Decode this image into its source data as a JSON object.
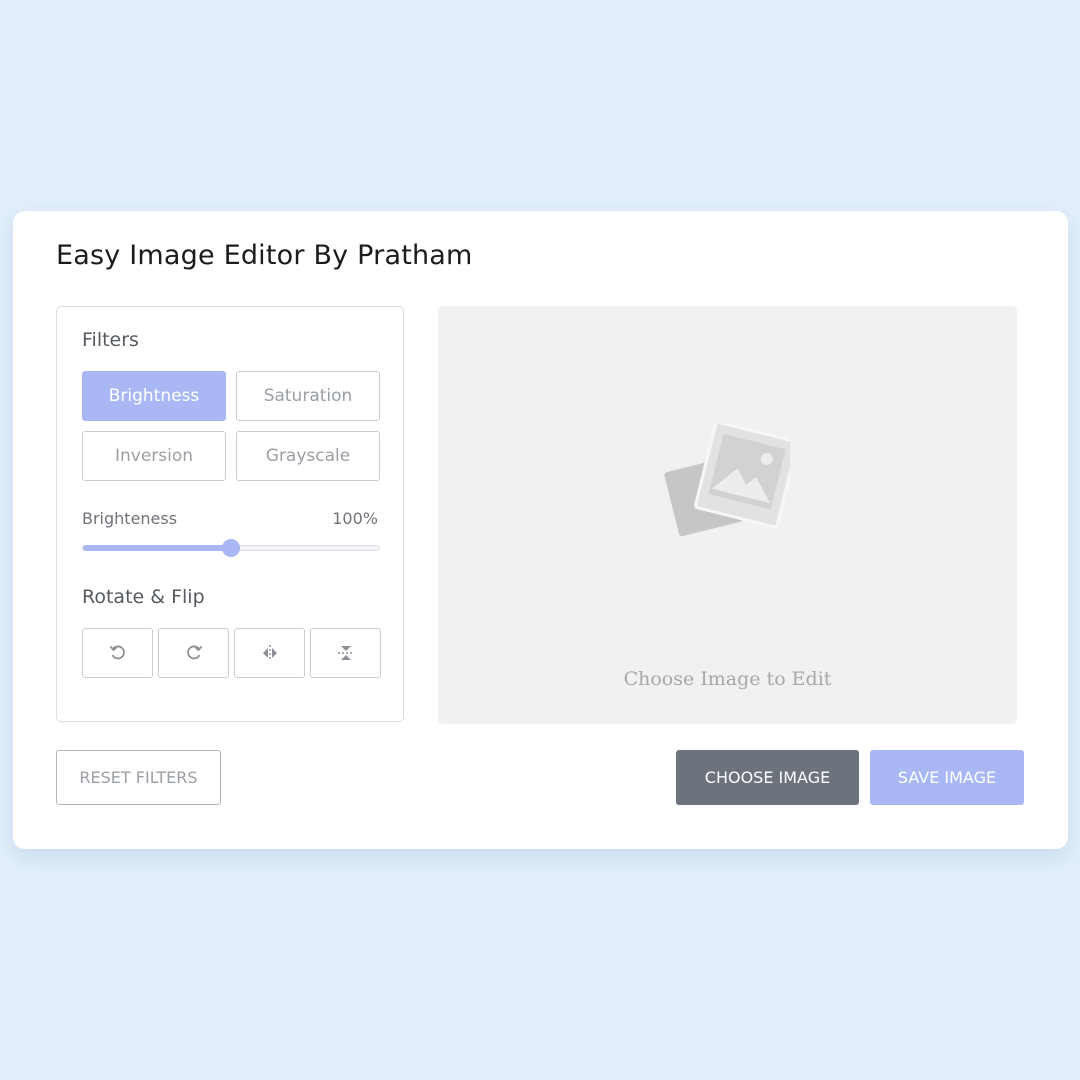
{
  "app": {
    "title": "Easy Image Editor By Pratham"
  },
  "filters": {
    "heading": "Filters",
    "options": [
      {
        "label": "Brightness",
        "active": true
      },
      {
        "label": "Saturation",
        "active": false
      },
      {
        "label": "Inversion",
        "active": false
      },
      {
        "label": "Grayscale",
        "active": false
      }
    ]
  },
  "slider": {
    "name": "Brighteness",
    "value_label": "100%",
    "value": 100,
    "min": 0,
    "max": 200
  },
  "rotate_flip": {
    "heading": "Rotate & Flip",
    "buttons": [
      {
        "icon": "rotate-left-icon"
      },
      {
        "icon": "rotate-right-icon"
      },
      {
        "icon": "flip-horizontal-icon"
      },
      {
        "icon": "flip-vertical-icon"
      }
    ]
  },
  "preview": {
    "placeholder_icon": "image-placeholder-icon",
    "placeholder_text": "Choose Image to Edit"
  },
  "actions": {
    "reset_label": "RESET FILTERS",
    "choose_label": "CHOOSE IMAGE",
    "save_label": "SAVE IMAGE"
  },
  "colors": {
    "accent": "#a9b8f5",
    "page_background": "#e3f0fc",
    "choose_button": "#6c737d"
  }
}
